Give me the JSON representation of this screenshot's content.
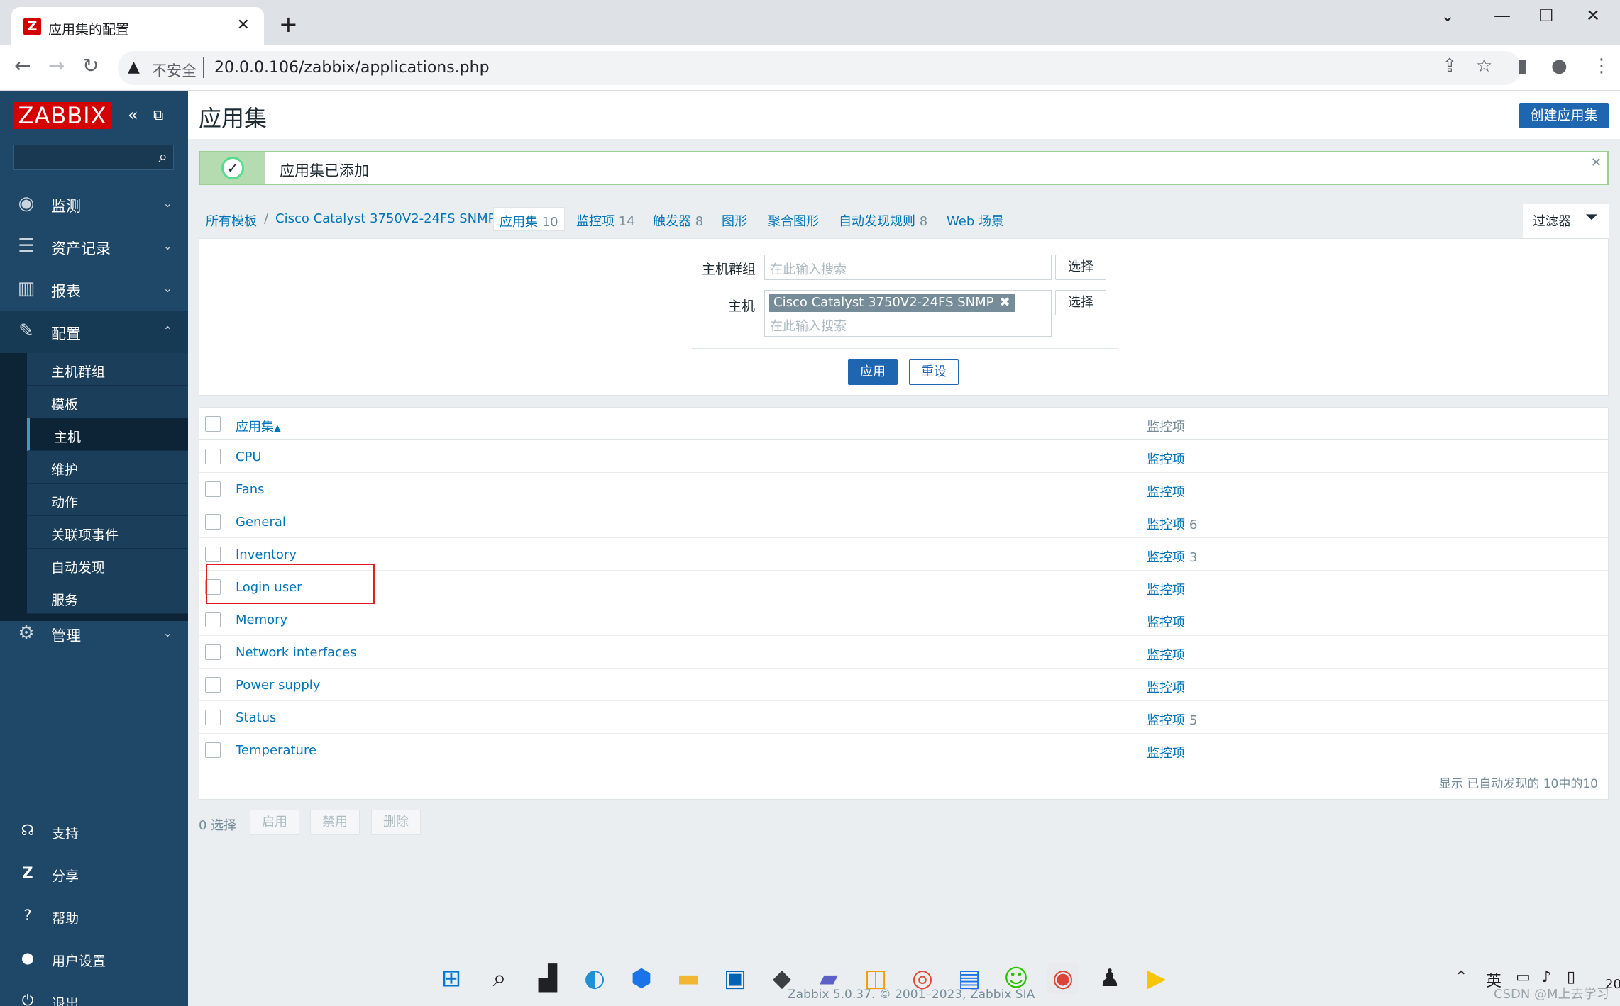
{
  "browser": {
    "tab_title": "应用集的配置",
    "tab_favicon": "Z",
    "insecure_label": "不安全",
    "url": "20.0.0.106/zabbix/applications.php"
  },
  "sidebar": {
    "logo": "ZABBIX",
    "menu": [
      {
        "label": "监测",
        "icon": "eye-icon"
      },
      {
        "label": "资产记录",
        "icon": "list-icon"
      },
      {
        "label": "报表",
        "icon": "chart-icon"
      },
      {
        "label": "配置",
        "icon": "wrench-icon"
      },
      {
        "label": "管理",
        "icon": "gear-icon"
      }
    ],
    "submenu": [
      "主机群组",
      "模板",
      "主机",
      "维护",
      "动作",
      "关联项事件",
      "自动发现",
      "服务"
    ],
    "bottom": [
      {
        "label": "支持",
        "icon": "headset-icon"
      },
      {
        "label": "分享",
        "icon": "share-icon"
      },
      {
        "label": "帮助",
        "icon": "help-icon"
      },
      {
        "label": "用户设置",
        "icon": "user-icon"
      },
      {
        "label": "退出",
        "icon": "power-icon"
      }
    ]
  },
  "header": {
    "title": "应用集",
    "create_button": "创建应用集"
  },
  "message": {
    "text": "应用集已添加"
  },
  "breadcrumbs": {
    "all_templates": "所有模板",
    "separator": "/",
    "template": "Cisco Catalyst 3750V2-24FS SNMP",
    "applications": "应用集",
    "applications_count": "10",
    "items": "监控项",
    "items_count": "14",
    "triggers": "触发器",
    "triggers_count": "8",
    "graphs": "图形",
    "screens": "聚合图形",
    "discovery": "自动发现规则",
    "discovery_count": "8",
    "web": "Web 场景"
  },
  "filter": {
    "tab_label": "过滤器",
    "host_group_label": "主机群组",
    "host_label": "主机",
    "placeholder": "在此输入搜索",
    "select_button": "选择",
    "host_chip": "Cisco Catalyst 3750V2-24FS SNMP",
    "apply_button": "应用",
    "reset_button": "重设"
  },
  "table": {
    "col_name": "应用集",
    "col_items": "监控项",
    "sort_indicator": "▲",
    "rows": [
      {
        "name": "CPU",
        "items": "监控项",
        "count": ""
      },
      {
        "name": "Fans",
        "items": "监控项",
        "count": ""
      },
      {
        "name": "General",
        "items": "监控项",
        "count": "6"
      },
      {
        "name": "Inventory",
        "items": "监控项",
        "count": "3"
      },
      {
        "name": "Login user",
        "items": "监控项",
        "count": ""
      },
      {
        "name": "Memory",
        "items": "监控项",
        "count": ""
      },
      {
        "name": "Network interfaces",
        "items": "监控项",
        "count": ""
      },
      {
        "name": "Power supply",
        "items": "监控项",
        "count": ""
      },
      {
        "name": "Status",
        "items": "监控项",
        "count": "5"
      },
      {
        "name": "Temperature",
        "items": "监控项",
        "count": ""
      }
    ],
    "summary": "显示 已自动发现的 10中的10"
  },
  "actions": {
    "selected": "0 选择",
    "enable": "启用",
    "disable": "禁用",
    "delete": "删除"
  },
  "footer": "Zabbix 5.0.37. © 2001–2023, Zabbix SIA",
  "taskbar": {
    "ime": "英",
    "clock_fragment": "20"
  },
  "watermark": "CSDN @M上去学习",
  "colors": {
    "sidebar_bg": "#1f4767",
    "primary": "#1f66b0",
    "link": "#0275b8",
    "logo_red": "#d40000",
    "success_border": "#9ad094",
    "highlight_box": "#e02020"
  }
}
